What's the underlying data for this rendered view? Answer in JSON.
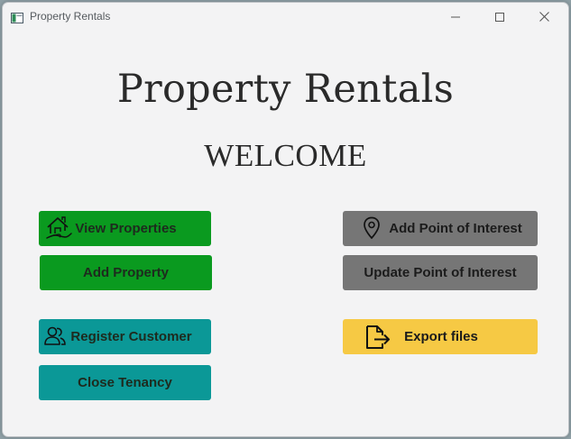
{
  "window": {
    "title": "Property Rentals"
  },
  "main": {
    "heading": "Property Rentals",
    "subheading": "WELCOME"
  },
  "buttons": {
    "view_properties": "View Properties",
    "add_property": "Add Property",
    "register_customer": "Register Customer",
    "close_tenancy": "Close Tenancy",
    "add_poi": "Add Point of Interest",
    "update_poi": "Update Point of Interest",
    "export_files": "Export files"
  },
  "icons": {
    "view_properties": "house-hand-icon",
    "register_customer": "users-icon",
    "add_poi": "location-pin-icon",
    "export_files": "file-export-icon"
  },
  "colors": {
    "green": "#0a9a1f",
    "teal": "#0b9897",
    "grey": "#767676",
    "yellow": "#f6c944",
    "window_bg": "#f3f3f4"
  }
}
